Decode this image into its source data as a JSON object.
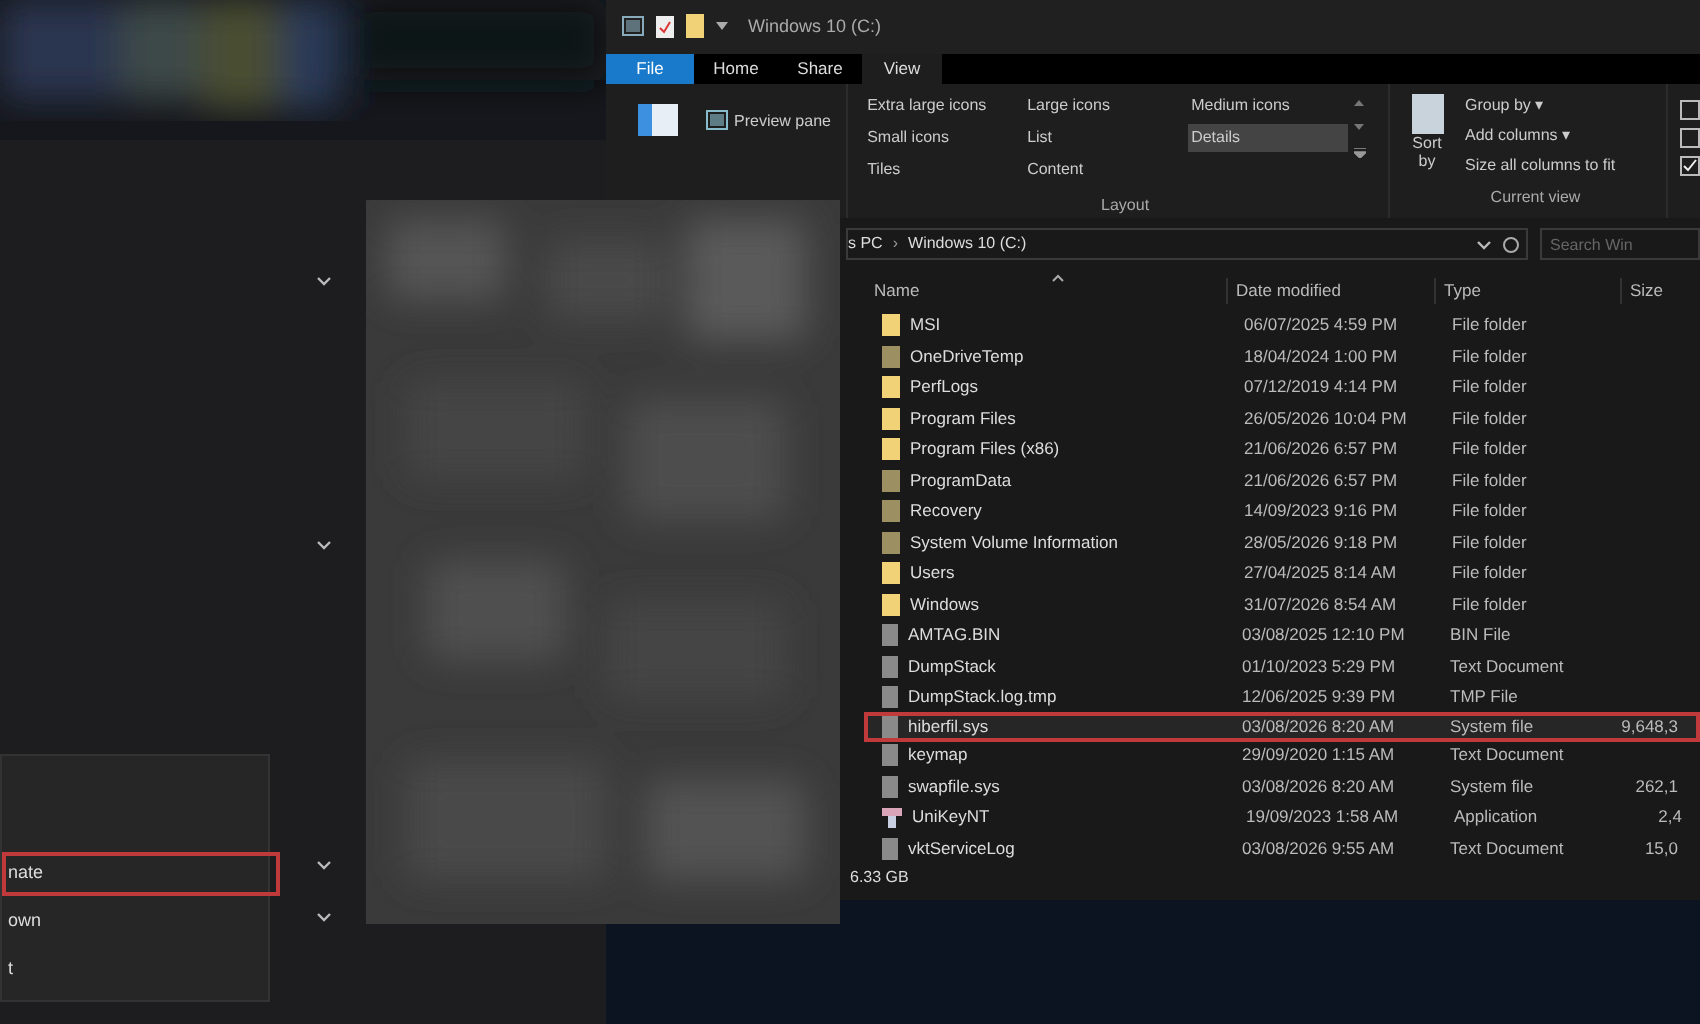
{
  "settings_menu": {
    "items": [
      {
        "label": "nate",
        "highlighted": true
      },
      {
        "label": "own",
        "highlighted": false
      },
      {
        "label": "t",
        "highlighted": false
      }
    ]
  },
  "explorer": {
    "title": "Windows 10 (C:)",
    "tabs": [
      {
        "label": "File",
        "selected": false,
        "kind": "file"
      },
      {
        "label": "Home",
        "selected": false,
        "kind": "tab"
      },
      {
        "label": "Share",
        "selected": false,
        "kind": "tab"
      },
      {
        "label": "View",
        "selected": true,
        "kind": "tab"
      }
    ],
    "panes": {
      "preview_pane": "Preview pane"
    },
    "layout": {
      "label": "Layout",
      "options": [
        {
          "label": "Extra large icons",
          "selected": false
        },
        {
          "label": "Large icons",
          "selected": false
        },
        {
          "label": "Medium icons",
          "selected": false
        },
        {
          "label": "Small icons",
          "selected": false
        },
        {
          "label": "List",
          "selected": false
        },
        {
          "label": "Details",
          "selected": true
        },
        {
          "label": "Tiles",
          "selected": false
        },
        {
          "label": "Content",
          "selected": false
        }
      ]
    },
    "current_view": {
      "label": "Current view",
      "sort_by": "Sort by",
      "group_by": "Group by ▾",
      "add_columns": "Add columns ▾",
      "size_columns": "Size all columns to fit",
      "checkboxes": [
        {
          "checked": false
        },
        {
          "checked": false
        },
        {
          "checked": true
        }
      ]
    },
    "address": {
      "path": [
        "s PC",
        "Windows 10 (C:)"
      ],
      "separator": "›"
    },
    "search": {
      "placeholder": "Search Win"
    },
    "columns": [
      "Name",
      "Date modified",
      "Type",
      "Size"
    ],
    "rows": [
      {
        "kind": "folder",
        "name": "MSI",
        "date": "06/07/2025 4:59 PM",
        "type": "File folder",
        "size": "",
        "highlighted": false
      },
      {
        "kind": "hidden-folder",
        "name": "OneDriveTemp",
        "date": "18/04/2024 1:00 PM",
        "type": "File folder",
        "size": "",
        "highlighted": false
      },
      {
        "kind": "folder",
        "name": "PerfLogs",
        "date": "07/12/2019 4:14 PM",
        "type": "File folder",
        "size": "",
        "highlighted": false
      },
      {
        "kind": "folder",
        "name": "Program Files",
        "date": "26/05/2026 10:04 PM",
        "type": "File folder",
        "size": "",
        "highlighted": false
      },
      {
        "kind": "folder",
        "name": "Program Files (x86)",
        "date": "21/06/2026 6:57 PM",
        "type": "File folder",
        "size": "",
        "highlighted": false
      },
      {
        "kind": "hidden-folder",
        "name": "ProgramData",
        "date": "21/06/2026 6:57 PM",
        "type": "File folder",
        "size": "",
        "highlighted": false
      },
      {
        "kind": "hidden-folder",
        "name": "Recovery",
        "date": "14/09/2023 9:16 PM",
        "type": "File folder",
        "size": "",
        "highlighted": false
      },
      {
        "kind": "hidden-folder",
        "name": "System Volume Information",
        "date": "28/05/2026 9:18 PM",
        "type": "File folder",
        "size": "",
        "highlighted": false
      },
      {
        "kind": "folder",
        "name": "Users",
        "date": "27/04/2025 8:14 AM",
        "type": "File folder",
        "size": "",
        "highlighted": false
      },
      {
        "kind": "folder",
        "name": "Windows",
        "date": "31/07/2026 8:54 AM",
        "type": "File folder",
        "size": "",
        "highlighted": false
      },
      {
        "kind": "file",
        "name": "AMTAG.BIN",
        "date": "03/08/2025 12:10 PM",
        "type": "BIN File",
        "size": "",
        "highlighted": false
      },
      {
        "kind": "file",
        "name": "DumpStack",
        "date": "01/10/2023 5:29 PM",
        "type": "Text Document",
        "size": "",
        "highlighted": false
      },
      {
        "kind": "file",
        "name": "DumpStack.log.tmp",
        "date": "12/06/2025 9:39 PM",
        "type": "TMP File",
        "size": "",
        "highlighted": false
      },
      {
        "kind": "file",
        "name": "hiberfil.sys",
        "date": "03/08/2026 8:20 AM",
        "type": "System file",
        "size": "9,648,3",
        "highlighted": true
      },
      {
        "kind": "file",
        "name": "keymap",
        "date": "29/09/2020 1:15 AM",
        "type": "Text Document",
        "size": "",
        "highlighted": false
      },
      {
        "kind": "file",
        "name": "swapfile.sys",
        "date": "03/08/2026 8:20 AM",
        "type": "System file",
        "size": "262,1",
        "highlighted": false
      },
      {
        "kind": "app",
        "name": "UniKeyNT",
        "date": "19/09/2023 1:58 AM",
        "type": "Application",
        "size": "2,4",
        "highlighted": false
      },
      {
        "kind": "file",
        "name": "vktServiceLog",
        "date": "03/08/2026 9:55 AM",
        "type": "Text Document",
        "size": "15,0",
        "highlighted": false
      }
    ],
    "status": "6.33 GB"
  }
}
